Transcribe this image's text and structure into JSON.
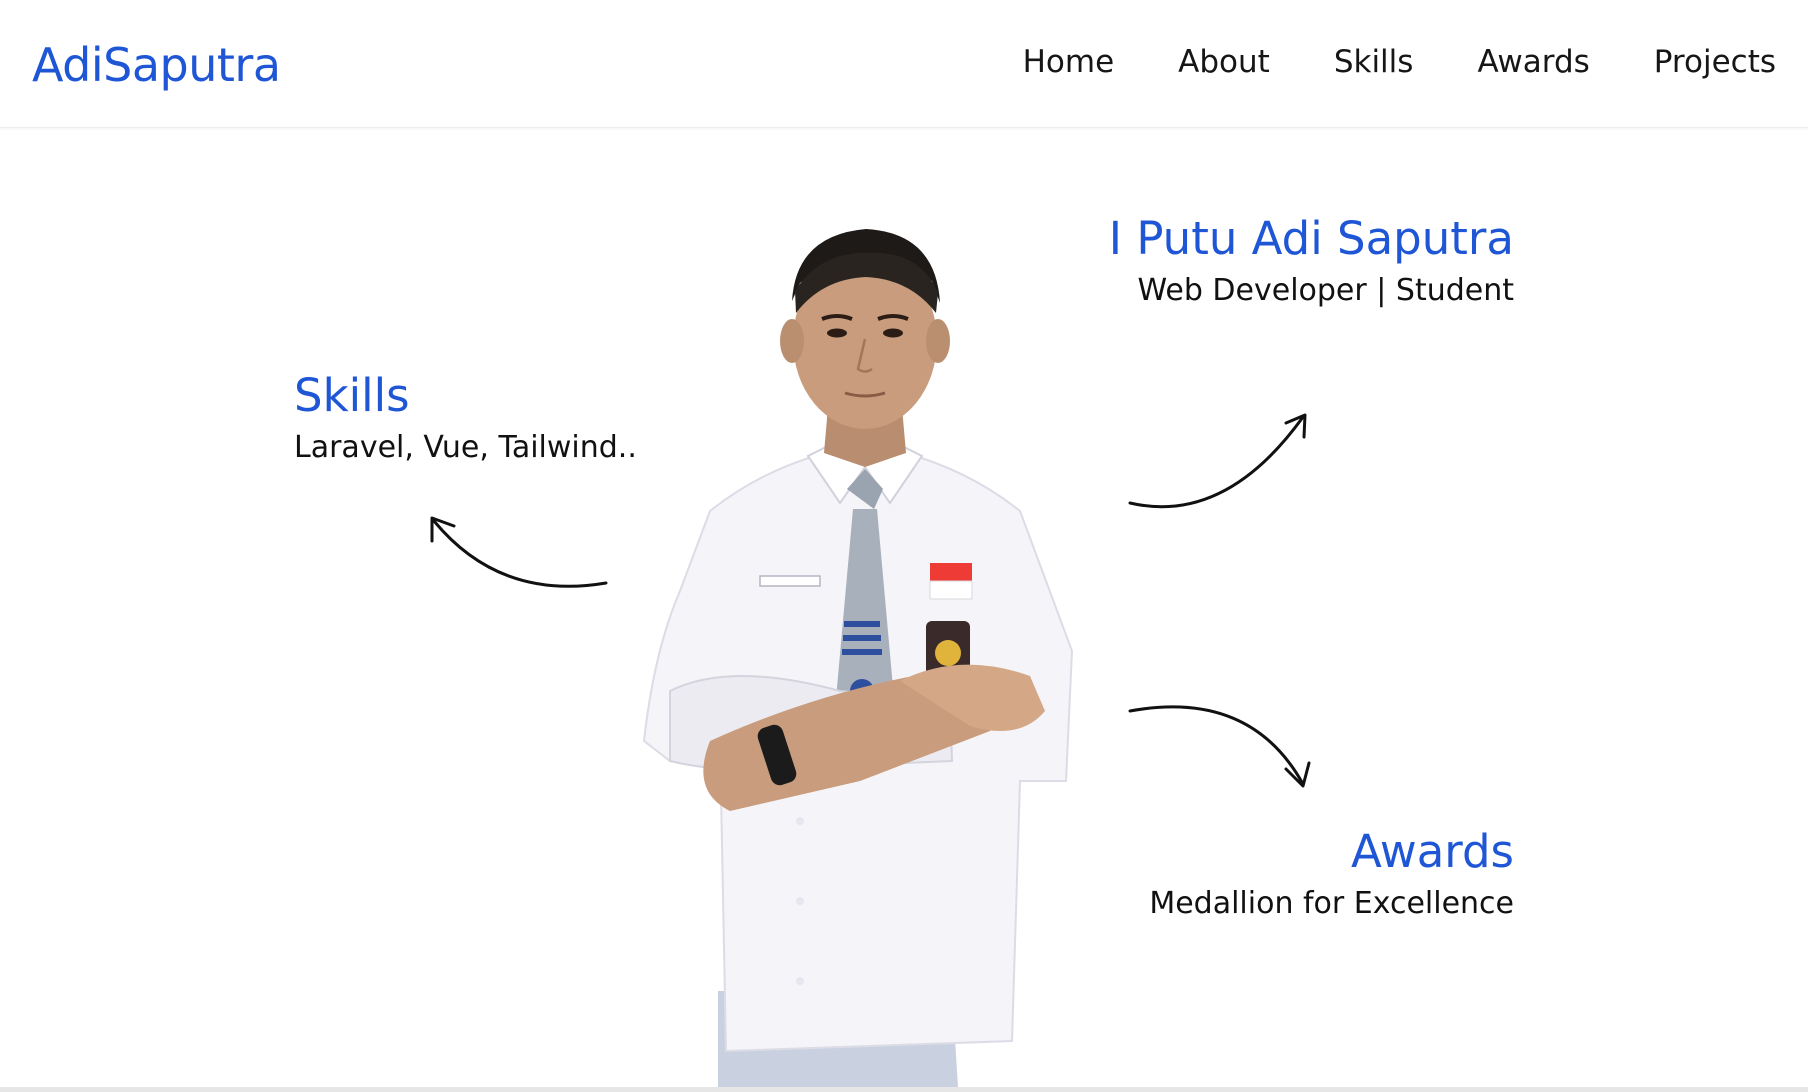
{
  "navbar": {
    "brand": "AdiSaputra",
    "links": [
      "Home",
      "About",
      "Skills",
      "Awards",
      "Projects"
    ]
  },
  "hero": {
    "name": "I Putu Adi Saputra",
    "role": "Web Developer | Student",
    "skills_title": "Skills",
    "skills_text": "Laravel, Vue, Tailwind..",
    "awards_title": "Awards",
    "awards_text": "Medallion for Excellence"
  },
  "colors": {
    "accent": "#1f56d6",
    "text": "#111111",
    "background": "#ffffff"
  }
}
